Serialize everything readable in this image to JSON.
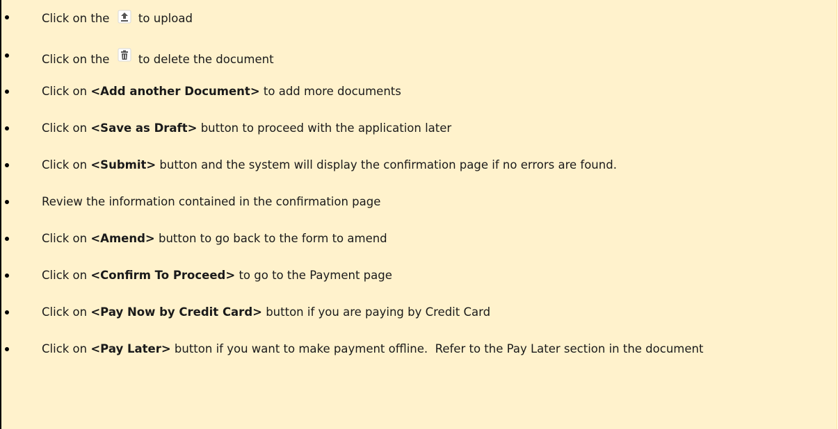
{
  "instructions": [
    {
      "pre": "Click on the ",
      "icon": "upload-icon",
      "post": " to upload"
    },
    {
      "pre": "Click on the ",
      "icon": "trash-icon",
      "post": " to delete the document"
    },
    {
      "pre": "Click on ",
      "bold": "<Add another Document>",
      "post": " to add more documents"
    },
    {
      "pre": "Click on ",
      "bold": "<Save as Draft>",
      "post": " button to proceed with the application later"
    },
    {
      "pre": "Click on ",
      "bold": "<Submit>",
      "post": " button and the system will display the confirmation page if no errors are found."
    },
    {
      "pre": "Review the information contained in the confirmation page"
    },
    {
      "pre": "Click on ",
      "bold": "<Amend>",
      "post": " button to go back to the form to amend"
    },
    {
      "pre": "Click on ",
      "bold": "<Confirm To Proceed>",
      "post": " to go to the Payment page"
    },
    {
      "pre": "Click on ",
      "bold": "<Pay Now by Credit Card>",
      "post": " button if you are paying by Credit Card"
    },
    {
      "pre": "Click on ",
      "bold": "<Pay Later>",
      "post": " button if you want to make payment offline.  Refer to the Pay Later section in the document"
    }
  ],
  "colors": {
    "highlight": "#fff2cc",
    "text": "#1a1a1a",
    "rule": "#000000"
  }
}
